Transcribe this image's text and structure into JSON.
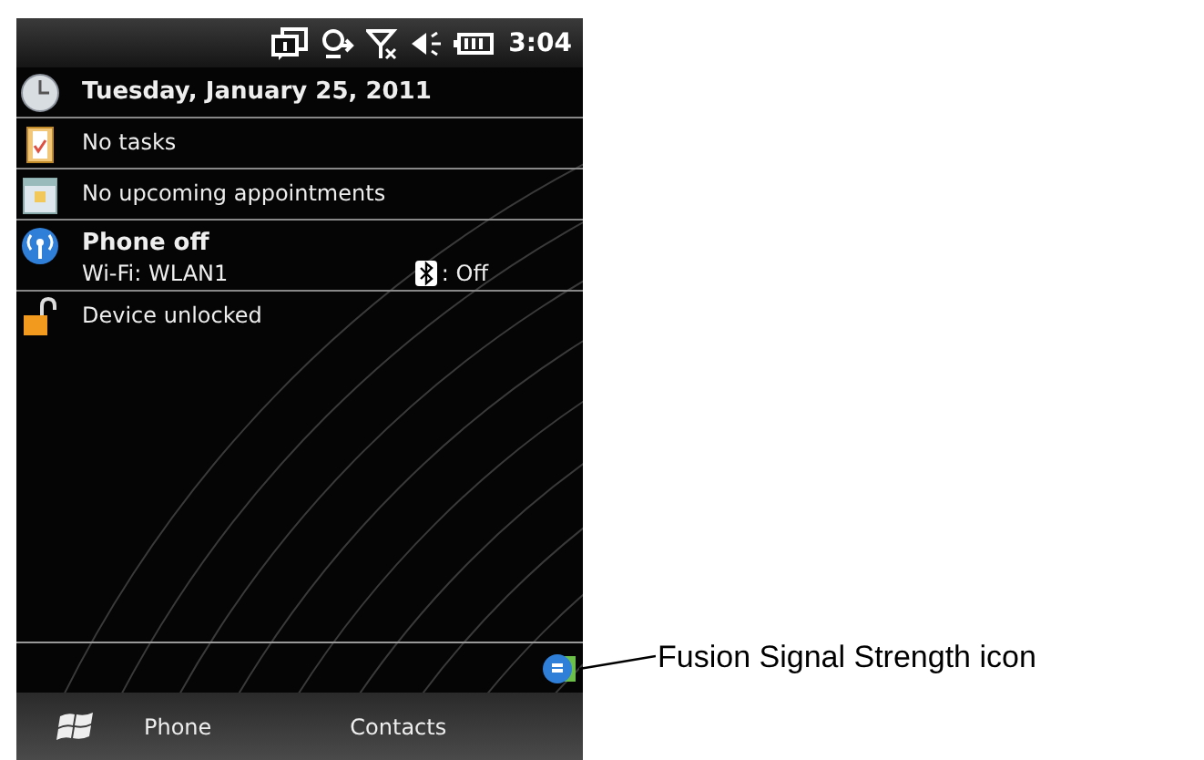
{
  "status_bar": {
    "time": "3:04"
  },
  "today": [
    {
      "kind": "date",
      "text": "Tuesday, January 25, 2011"
    },
    {
      "kind": "tasks",
      "text": "No tasks"
    },
    {
      "kind": "calendar",
      "text": "No upcoming appointments"
    },
    {
      "kind": "wireless",
      "title": "Phone off",
      "detail": "Wi-Fi: WLAN1",
      "bluetooth": ": Off"
    },
    {
      "kind": "lock",
      "text": "Device unlocked"
    }
  ],
  "softkeys": [
    "Phone",
    "Contacts"
  ],
  "annotation": {
    "text": "Fusion Signal Strength icon"
  }
}
